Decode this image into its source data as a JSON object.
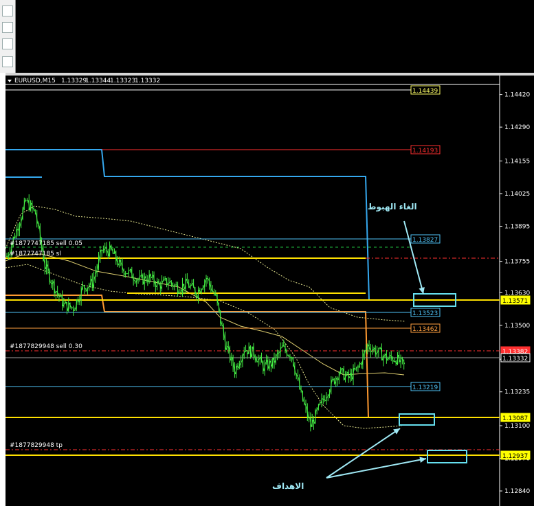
{
  "chart_data": {
    "type": "candlestick",
    "title": "EURUSD,M15",
    "ohlc_header": [
      "1.13329",
      "1.13344",
      "1.13323",
      "1.13332"
    ],
    "ylim": [
      1.1278,
      1.1446
    ],
    "y_ticks": [
      "1.14420",
      "1.14290",
      "1.14155",
      "1.14025",
      "1.13895",
      "1.13755",
      "1.13630",
      "1.13500",
      "1.13365",
      "1.13235",
      "1.13100",
      "1.12970",
      "1.12840"
    ],
    "price_labels": [
      {
        "value": "1.14439",
        "color": "#ffff66"
      },
      {
        "value": "1.14193",
        "color": "#ff3030"
      },
      {
        "value": "1.13827",
        "color": "#4fc3f7"
      },
      {
        "value": "1.13571",
        "color": "#ffff00"
      },
      {
        "value": "1.13523",
        "color": "#4fc3f7"
      },
      {
        "value": "1.13462",
        "color": "#ffa040"
      },
      {
        "value": "1.13382",
        "color": "#ff3030"
      },
      {
        "value": "1.13332",
        "color": "#ffffff"
      },
      {
        "value": "1.13219",
        "color": "#4fc3f7"
      },
      {
        "value": "1.13087",
        "color": "#ffff00"
      },
      {
        "value": "1.12937",
        "color": "#ffff00"
      }
    ],
    "order_labels": [
      "#1877747185 sell 0.05",
      "#1877747185 sl",
      "#1877829948 sell 0.30",
      "#1877829948 tp"
    ],
    "annotations": [
      "الغاء الهبوط",
      "الاهداف"
    ],
    "series": [
      {
        "name": "",
        "values": [
          1.13775,
          1.1388,
          1.13995,
          1.13945,
          1.13735,
          1.1365,
          1.1358,
          1.1357,
          1.1365,
          1.1367,
          1.138,
          1.13795,
          1.1373,
          1.13705,
          1.1368,
          1.1369,
          1.1366,
          1.13675,
          1.1365,
          1.13665,
          1.1363,
          1.1369,
          1.1361,
          1.13425,
          1.1332,
          1.13408,
          1.1339,
          1.13335,
          1.1335,
          1.1341,
          1.1338,
          1.1322,
          1.131,
          1.1318,
          1.13255,
          1.13315,
          1.1329,
          1.1333,
          1.1342,
          1.13395,
          1.1337,
          1.13367,
          1.13332
        ]
      }
    ],
    "grid": false
  }
}
